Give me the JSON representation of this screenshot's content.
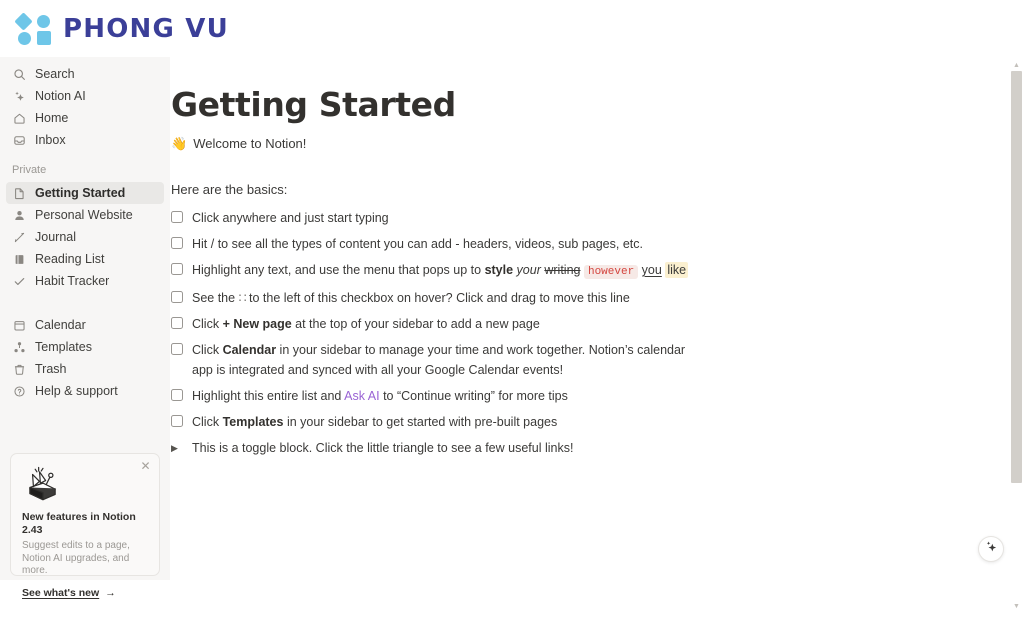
{
  "brand": {
    "name": "PHONG VU",
    "logo_icon": "phong-vu-logo",
    "accent": "#6ec6e8",
    "text_color": "#3b3f98"
  },
  "sidebar": {
    "top_items": [
      {
        "label": "Search",
        "icon": "search-icon"
      },
      {
        "label": "Notion AI",
        "icon": "sparkle-icon"
      },
      {
        "label": "Home",
        "icon": "home-icon"
      },
      {
        "label": "Inbox",
        "icon": "inbox-icon"
      }
    ],
    "section_label": "Private",
    "private_items": [
      {
        "label": "Getting Started",
        "icon": "page-icon",
        "active": true
      },
      {
        "label": "Personal Website",
        "icon": "person-icon",
        "active": false
      },
      {
        "label": "Journal",
        "icon": "pencil-icon",
        "active": false
      },
      {
        "label": "Reading List",
        "icon": "book-icon",
        "active": false
      },
      {
        "label": "Habit Tracker",
        "icon": "check-icon",
        "active": false
      }
    ],
    "bottom_items": [
      {
        "label": "Calendar",
        "icon": "calendar-icon"
      },
      {
        "label": "Templates",
        "icon": "templates-icon"
      },
      {
        "label": "Trash",
        "icon": "trash-icon"
      },
      {
        "label": "Help & support",
        "icon": "help-circle-icon"
      }
    ],
    "promo": {
      "title": "New features in Notion 2.43",
      "description": "Suggest edits to a page, Notion AI upgrades, and more.",
      "link_label": "See what's new",
      "link_arrow": "→",
      "close_icon": "close-icon",
      "art_icon": "confetti-box-icon"
    }
  },
  "document": {
    "title": "Getting Started",
    "welcome_emoji": "👋",
    "welcome_text": "Welcome to Notion!",
    "basics_label": "Here are the basics:",
    "items": [
      {
        "kind": "todo",
        "parts": [
          {
            "t": "Click anywhere and just start typing",
            "f": "plain"
          }
        ]
      },
      {
        "kind": "todo",
        "parts": [
          {
            "t": "Hit / to see all the types of content you can add - headers, videos, sub pages, etc.",
            "f": "plain"
          }
        ]
      },
      {
        "kind": "todo",
        "parts": [
          {
            "t": "Highlight any text, and use the menu that pops up to ",
            "f": "plain"
          },
          {
            "t": "style",
            "f": "bold"
          },
          {
            "t": " ",
            "f": "plain"
          },
          {
            "t": "your",
            "f": "italic"
          },
          {
            "t": " ",
            "f": "plain"
          },
          {
            "t": "writing",
            "f": "strike"
          },
          {
            "t": " ",
            "f": "plain"
          },
          {
            "t": "however",
            "f": "code"
          },
          {
            "t": " ",
            "f": "plain"
          },
          {
            "t": "you",
            "f": "underline"
          },
          {
            "t": " ",
            "f": "plain"
          },
          {
            "t": "like",
            "f": "highlight"
          }
        ]
      },
      {
        "kind": "todo",
        "parts": [
          {
            "t": "See the ",
            "f": "plain"
          },
          {
            "t": "∷",
            "f": "dots"
          },
          {
            "t": " to the left of this checkbox on hover? Click and drag to move this line",
            "f": "plain"
          }
        ]
      },
      {
        "kind": "todo",
        "parts": [
          {
            "t": "Click ",
            "f": "plain"
          },
          {
            "t": "+ New page",
            "f": "bold"
          },
          {
            "t": " at the top of your sidebar to add a new page",
            "f": "plain"
          }
        ]
      },
      {
        "kind": "todo",
        "parts": [
          {
            "t": "Click ",
            "f": "plain"
          },
          {
            "t": "Calendar",
            "f": "bold"
          },
          {
            "t": " in your sidebar to manage your time and work together. Notion’s calendar app is integrated and synced with all your Google Calendar events!",
            "f": "plain"
          }
        ]
      },
      {
        "kind": "todo",
        "parts": [
          {
            "t": "Highlight this entire list and ",
            "f": "plain"
          },
          {
            "t": "Ask AI",
            "f": "ai"
          },
          {
            "t": " to “Continue writing” for more tips",
            "f": "plain"
          }
        ]
      },
      {
        "kind": "todo",
        "parts": [
          {
            "t": "Click ",
            "f": "plain"
          },
          {
            "t": "Templates",
            "f": "bold"
          },
          {
            "t": " in your sidebar to get started with pre-built pages",
            "f": "plain"
          }
        ]
      },
      {
        "kind": "toggle",
        "parts": [
          {
            "t": "This is a toggle block. Click the little triangle to see a few useful links!",
            "f": "plain"
          }
        ]
      }
    ]
  },
  "fab": {
    "icon": "sparkle-icon"
  },
  "scrollbar": {
    "up_icon": "caret-up-icon",
    "down_icon": "caret-down-icon",
    "thumb_icon": "scroll-thumb"
  }
}
